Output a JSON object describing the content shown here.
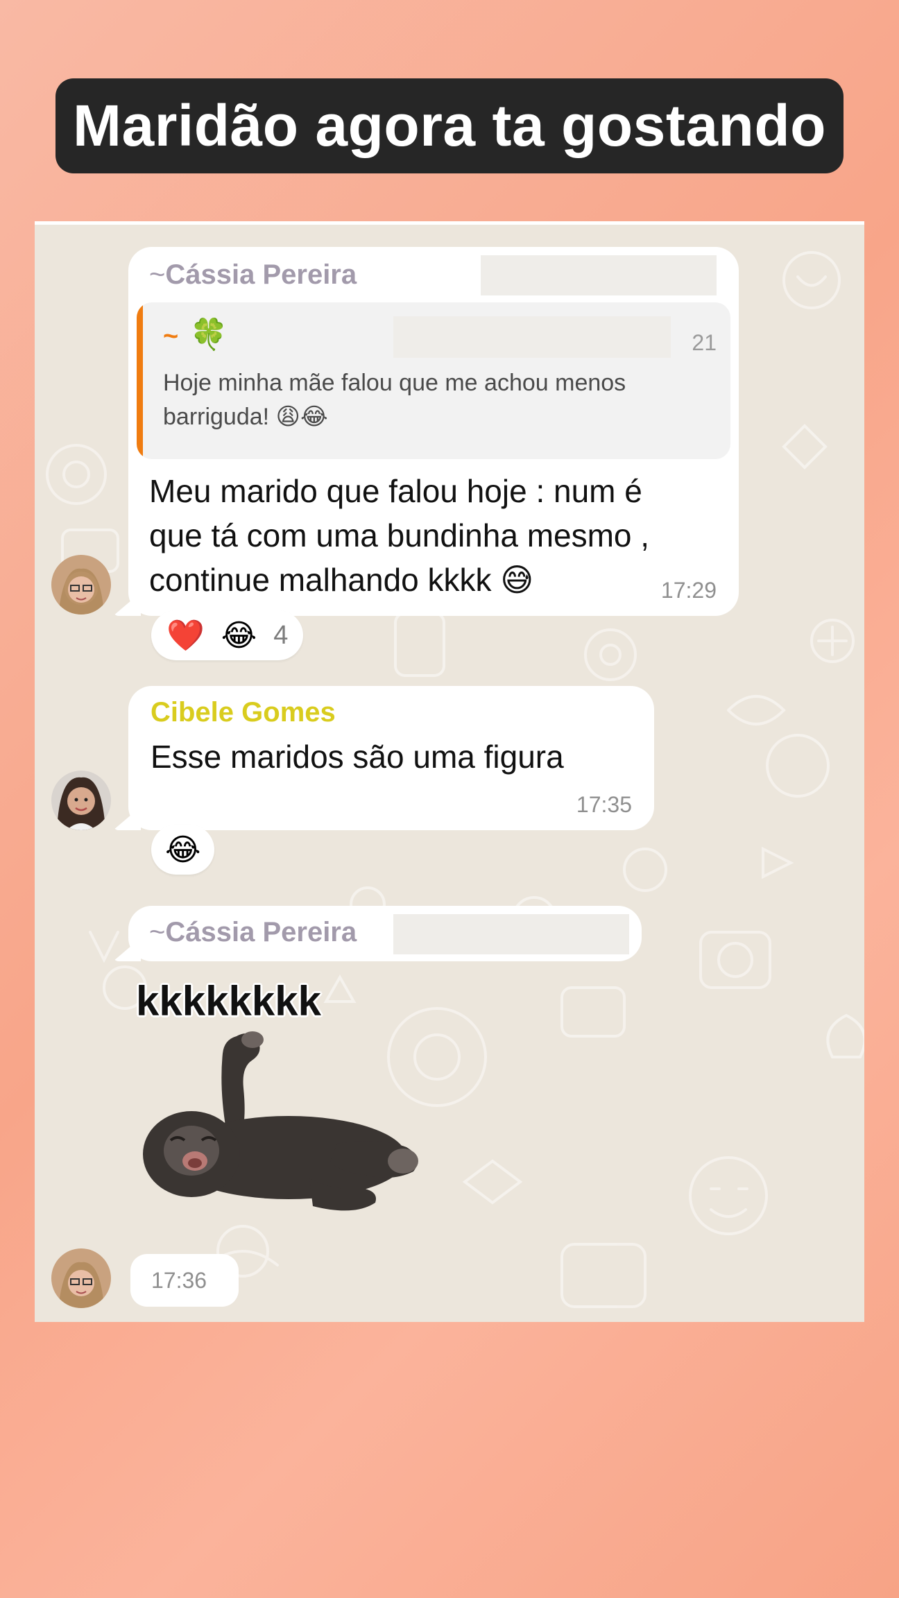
{
  "story": {
    "title": "Maridão agora ta gostando"
  },
  "messages": [
    {
      "sender_prefix": "~",
      "sender": "Cássia Pereira",
      "quoted": {
        "sender_prefix": "~",
        "sender_icon": "four-leaf-clover",
        "sender_emoji": "🍀",
        "time_fragment": "21",
        "text": "Hoje minha mãe falou que me achou menos barriguda! 😩😂"
      },
      "lines": [
        "Meu marido que falou hoje : num é",
        "que tá com uma bundinha mesmo ,",
        "continue malhando kkkk 😅"
      ],
      "time": "17:29",
      "reactions": {
        "emojis": [
          "❤️",
          "😂"
        ],
        "count": "4"
      }
    },
    {
      "sender": "Cibele Gomes",
      "text": "Esse maridos são uma figura",
      "time": "17:35",
      "reactions": {
        "emojis": [
          "😂"
        ]
      }
    },
    {
      "sender_prefix": "~",
      "sender": "Cássia Pereira",
      "sticker": {
        "caption": "kkkkkkkk",
        "icon": "laughing-chimp-sticker"
      },
      "time": "17:36"
    }
  ],
  "colors": {
    "background": "#f8a589",
    "title_bg": "#262626",
    "chat_bg": "#ece6dc",
    "quote_accent": "#f07c10",
    "sender_gray": "#a29aab",
    "sender_yellow": "#d9cc1e"
  }
}
